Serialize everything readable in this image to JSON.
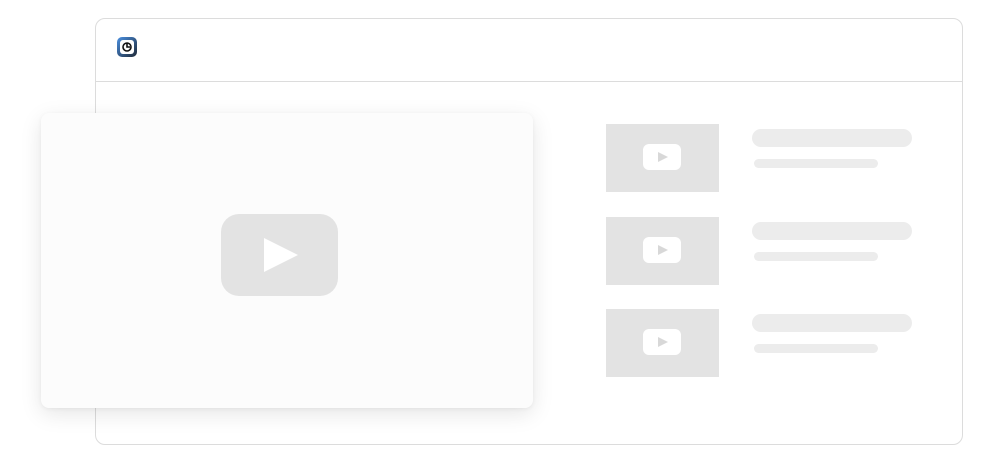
{
  "app": {
    "logo_icon": "app-logo-icon",
    "accent_color": "#3b82f6"
  },
  "player": {
    "play_icon": "play-icon",
    "placeholder_color": "#e3e3e3"
  },
  "related_videos": [
    {
      "thumbnail_icon": "play-icon"
    },
    {
      "thumbnail_icon": "play-icon"
    },
    {
      "thumbnail_icon": "play-icon"
    }
  ]
}
